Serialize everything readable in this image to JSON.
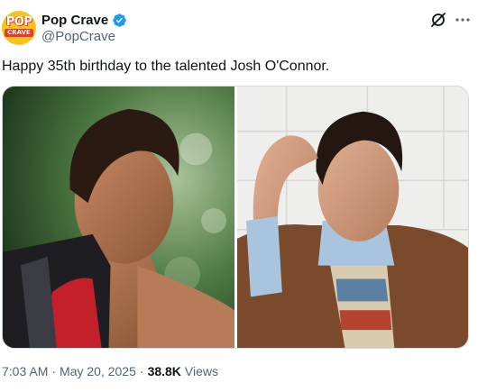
{
  "author": {
    "display_name": "Pop Crave",
    "handle": "@PopCrave",
    "avatar_text_top": "POP",
    "avatar_text_bottom": "CRAVE",
    "avatar_color": "#f7c41a",
    "verified": true,
    "verified_color": "#1d9bf0"
  },
  "header_actions": {
    "grok_icon": "grok-icon",
    "more_icon": "more-dots-icon"
  },
  "tweet": {
    "text": "Happy 35th birthday to the talented Josh O'Connor."
  },
  "media": [
    {
      "name": "photo-left",
      "icon": "photo"
    },
    {
      "name": "photo-right",
      "icon": "photo"
    }
  ],
  "meta": {
    "time": "7:03 AM",
    "separator": "·",
    "date": "May 20, 2025",
    "views_count": "38.8K",
    "views_label": "Views"
  }
}
